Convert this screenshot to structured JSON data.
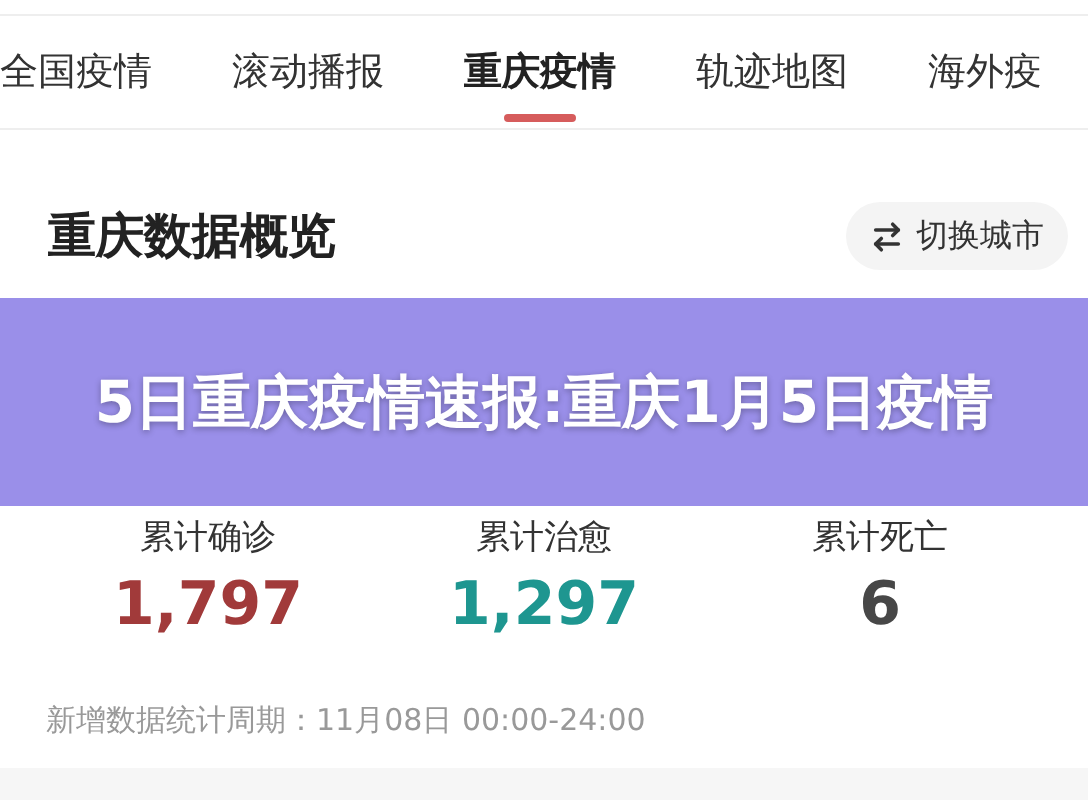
{
  "tabs": [
    {
      "label": "全国疫情",
      "selected": false
    },
    {
      "label": "滚动播报",
      "selected": false
    },
    {
      "label": "重庆疫情",
      "selected": true
    },
    {
      "label": "轨迹地图",
      "selected": false
    },
    {
      "label": "海外疫",
      "selected": false
    }
  ],
  "overview": {
    "title": "重庆数据概览",
    "switch_button": "切换城市"
  },
  "banner": {
    "title": "5日重庆疫情速报:重庆1月5日疫情"
  },
  "stats": [
    {
      "label": "累计确诊",
      "value": "1,797",
      "color": "#a13a3a"
    },
    {
      "label": "累计治愈",
      "value": "1,297",
      "color": "#1e9690"
    },
    {
      "label": "累计死亡",
      "value": "6",
      "color": "#474747"
    }
  ],
  "footnote": "新增数据统计周期：11月08日 00:00-24:00"
}
